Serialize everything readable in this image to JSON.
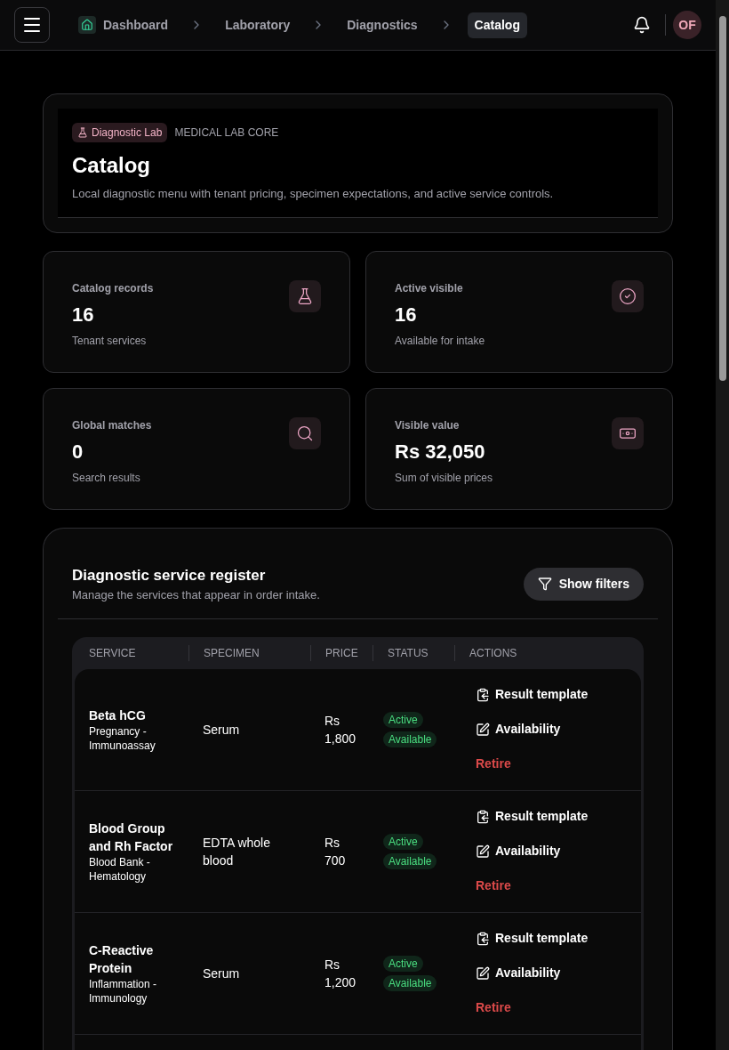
{
  "breadcrumbs": [
    {
      "label": "Dashboard",
      "selected": false
    },
    {
      "label": "Laboratory",
      "selected": false
    },
    {
      "label": "Diagnostics",
      "selected": false
    },
    {
      "label": "Catalog",
      "selected": true
    }
  ],
  "user": {
    "initials": "OF"
  },
  "hero": {
    "badge": "Diagnostic Lab",
    "eyebrow": "MEDICAL LAB CORE",
    "title": "Catalog",
    "description": "Local diagnostic menu with tenant pricing, specimen expectations, and active service controls."
  },
  "stats": [
    {
      "label": "Catalog records",
      "value": "16",
      "caption": "Tenant services",
      "kind": "flask"
    },
    {
      "label": "Active visible",
      "value": "16",
      "caption": "Available for intake",
      "kind": "check"
    },
    {
      "label": "Global matches",
      "value": "0",
      "caption": "Search results",
      "kind": "search"
    },
    {
      "label": "Visible value",
      "value": "Rs 32,050",
      "caption": "Sum of visible prices",
      "kind": "money"
    }
  ],
  "register": {
    "title": "Diagnostic service register",
    "subtitle": "Manage the services that appear in order intake.",
    "filter_button": "Show filters",
    "columns": [
      "SERVICE",
      "SPECIMEN",
      "PRICE",
      "STATUS",
      "ACTIONS"
    ],
    "rows": [
      {
        "name": "Beta hCG",
        "category": "Pregnancy - Immunoassay",
        "specimen": "Serum",
        "price_currency": "Rs",
        "price": "1,800",
        "status": "Active",
        "availability": "Available",
        "actions": [
          "Result template",
          "Availability",
          "Retire"
        ]
      },
      {
        "name": "Blood Group and Rh Factor",
        "category": "Blood Bank - Hematology",
        "specimen": "EDTA whole blood",
        "price_currency": "Rs",
        "price": "700",
        "status": "Active",
        "availability": "Available",
        "actions": [
          "Result template",
          "Availability",
          "Retire"
        ]
      },
      {
        "name": "C-Reactive Protein",
        "category": "Inflammation - Immunology",
        "specimen": "Serum",
        "price_currency": "Rs",
        "price": "1,200",
        "status": "Active",
        "availability": "Available",
        "actions": [
          "Result template",
          "Availability",
          "Retire"
        ]
      }
    ]
  }
}
